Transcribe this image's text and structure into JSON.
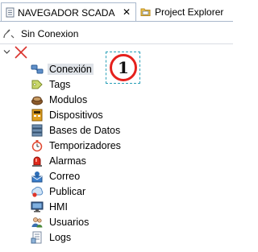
{
  "tabs": [
    {
      "label": "NAVEGADOR SCADA",
      "icon": "document-icon",
      "close": "✕"
    },
    {
      "label": "Project Explorer",
      "icon": "folder-icon"
    }
  ],
  "status": {
    "label": "Sin Conexion",
    "icon": "disconnected-plug-icon"
  },
  "tree": {
    "root_icon": "disconnected-x-icon",
    "items": [
      {
        "label": "Conexión",
        "icon": "connection-icon",
        "selected": true
      },
      {
        "label": "Tags",
        "icon": "tag-icon"
      },
      {
        "label": "Modulos",
        "icon": "module-icon"
      },
      {
        "label": "Dispositivos",
        "icon": "device-icon"
      },
      {
        "label": "Bases de Datos",
        "icon": "database-icon"
      },
      {
        "label": "Temporizadores",
        "icon": "stopwatch-icon"
      },
      {
        "label": "Alarmas",
        "icon": "alarm-icon"
      },
      {
        "label": "Correo",
        "icon": "mail-icon"
      },
      {
        "label": "Publicar",
        "icon": "publish-icon"
      },
      {
        "label": "HMI",
        "icon": "monitor-icon"
      },
      {
        "label": "Usuarios",
        "icon": "users-icon"
      },
      {
        "label": "Logs",
        "icon": "logs-icon"
      }
    ]
  },
  "annotation": {
    "number": "1"
  }
}
